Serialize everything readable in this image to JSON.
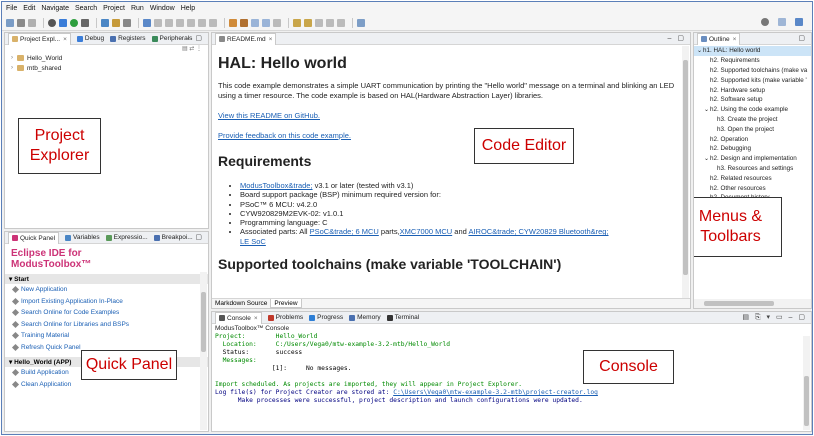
{
  "menu": [
    "File",
    "Edit",
    "Navigate",
    "Search",
    "Project",
    "Run",
    "Window",
    "Help"
  ],
  "toolbar_icons": [
    "new-icon",
    "save-icon",
    "build-icon",
    "debug-icon",
    "run-icon",
    "search-icon",
    "perspective-icon"
  ],
  "left_tabs": {
    "project_explorer": "Project Expl...",
    "debug": "Debug",
    "registers": "Registers",
    "peripherals": "Peripherals"
  },
  "project_tree": [
    "Hello_World",
    "mtb_shared"
  ],
  "callouts": {
    "project_explorer": "Project\nExplorer",
    "code_editor": "Code Editor",
    "menus_toolbars": "Menus &\nToolbars",
    "quick_panel": "Quick Panel",
    "console": "Console"
  },
  "bottom_left_tabs": {
    "quick_panel": "Quick Panel",
    "variables": "Variables",
    "expressions": "Expressio...",
    "breakpoints": "Breakpoi..."
  },
  "quick_panel": {
    "title_line1": "Eclipse IDE for",
    "title_line2": "ModusToolbox™",
    "start_section": "Start",
    "start_items": [
      "New Application",
      "Import Existing Application In-Place",
      "Search Online for Code Examples",
      "Search Online for Libraries and BSPs",
      "Training Material",
      "Refresh Quick Panel"
    ],
    "project_section": "Hello_World (APP)",
    "project_items": [
      "Build Application",
      "Clean Application"
    ]
  },
  "editor": {
    "tab": "README.md",
    "h1": "HAL: Hello world",
    "intro": "This code example demonstrates a simple UART communication by printing the \"Hello world\" message on a terminal and blinking an LED using a timer resource. The code example is based on HAL(Hardware Abstraction Layer) libraries.",
    "link1": "View this README on GitHub.",
    "link2": "Provide feedback on this code example.",
    "h2_requirements": "Requirements",
    "req": {
      "r1_link": "ModusToolbox&trade;",
      "r1_text": " v3.1 or later (tested with v3.1)",
      "r2": "Board support package (BSP) minimum required version for:",
      "r3": "PSoC™ 6 MCU: v4.2.0",
      "r4": "CYW920829M2EVK-02: v1.0.1",
      "r5": "Programming language: C",
      "r6_prefix": "Associated parts: All ",
      "r6_link1": "PSoC&trade; 6 MCU",
      "r6_mid1": " parts,",
      "r6_link2": "XMC7000 MCU",
      "r6_mid2": " and ",
      "r6_link3": "AIROC&trade; CYW20829 Bluetooth&reg;",
      "r6_link4": "LE SoC"
    },
    "h2_toolchains": "Supported toolchains (make variable 'TOOLCHAIN')",
    "bottom_tabs": [
      "Markdown Source",
      "Preview"
    ]
  },
  "outline": {
    "tab": "Outline",
    "items": [
      {
        "indent": 0,
        "text": "h1. HAL: Hello world",
        "exp": "v",
        "sel": true
      },
      {
        "indent": 1,
        "text": "h2. Requirements",
        "exp": ""
      },
      {
        "indent": 1,
        "text": "h2. Supported toolchains (make va",
        "exp": ""
      },
      {
        "indent": 1,
        "text": "h2. Supported kits (make variable '",
        "exp": ""
      },
      {
        "indent": 1,
        "text": "h2. Hardware setup",
        "exp": ""
      },
      {
        "indent": 1,
        "text": "h2. Software setup",
        "exp": ""
      },
      {
        "indent": 1,
        "text": "h2. Using the code example",
        "exp": "v"
      },
      {
        "indent": 2,
        "text": "h3. Create the project",
        "exp": ""
      },
      {
        "indent": 2,
        "text": "h3. Open the project",
        "exp": ""
      },
      {
        "indent": 1,
        "text": "h2. Operation",
        "exp": ""
      },
      {
        "indent": 1,
        "text": "h2. Debugging",
        "exp": ""
      },
      {
        "indent": 1,
        "text": "h2. Design and implementation",
        "exp": "v"
      },
      {
        "indent": 2,
        "text": "h3. Resources and settings",
        "exp": ""
      },
      {
        "indent": 1,
        "text": "h2. Related resources",
        "exp": ""
      },
      {
        "indent": 1,
        "text": "h2. Other resources",
        "exp": ""
      },
      {
        "indent": 1,
        "text": "h2. Document history",
        "exp": ""
      }
    ]
  },
  "console": {
    "tabs": [
      "Console",
      "Problems",
      "Progress",
      "Memory",
      "Terminal"
    ],
    "subtitle": "ModusToolbox™ Console",
    "lines": [
      {
        "t": "Project:        Hello_World",
        "c": "green"
      },
      {
        "t": "  Location:     C:/Users/Vega0/mtw-example-3.2-mtb/Hello_World",
        "c": "green"
      },
      {
        "t": "  Status:       success",
        "c": ""
      },
      {
        "t": "  Messages:",
        "c": "green"
      },
      {
        "t": "               [1]:     No messages.",
        "c": ""
      },
      {
        "t": "",
        "c": ""
      },
      {
        "t": "Import scheduled. As projects are imported, they will appear in Project Explorer.",
        "c": "green"
      }
    ],
    "log_prefix": "Log file(s) for Project Creator are stored at: ",
    "log_link": "C:\\Users\\Vega0\\mtw-example-3.2-mtb\\project-creator.log",
    "final_line": "      Make processes were successful, project description and launch configurations were updated."
  },
  "colors": {
    "accent": "#cc3377",
    "link": "#1a5fb4",
    "callout_text": "#cc0000",
    "console_green": "#008a00"
  }
}
